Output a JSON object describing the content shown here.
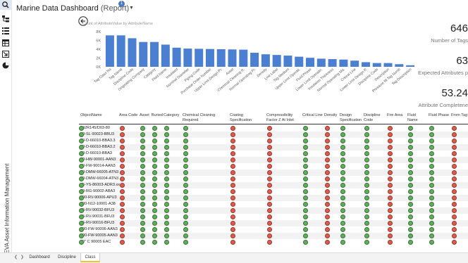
{
  "app": {
    "title": "Marine Data Dashboard",
    "subtitle": "(Report)",
    "badge": "1",
    "vertical_title": "AVEVA Asset Information Management"
  },
  "rail": {
    "icons": [
      "search-icon",
      "hierarchy-icon",
      "list-icon",
      "table-icon",
      "import-icon",
      "pie-icon"
    ]
  },
  "chart_data": {
    "type": "bar",
    "title": "Count of AttributeValue by AttributeName",
    "color": "#4a7fd2",
    "ylim": [
      0,
      8000
    ],
    "yticks": [
      "0K",
      "2K",
      "4K",
      "6K",
      "8K"
    ],
    "categories": [
      "Tag Class Na",
      "Tag Name",
      "Discipline Code",
      "Originating Company",
      "Category",
      "Fluid Name",
      "Insulated",
      "Nominal Diameter",
      "Piping Code",
      "Purchase Order Number",
      "Upper Limit Design Pr.",
      "Asset",
      "Chemical Cleaning R.",
      "Normal Operating Pr.",
      "Density",
      "Line Label",
      "Tag Medium",
      "Upper Limit Operati.",
      "Fluid Phase",
      "Lower Limit Operatin.",
      "Insulation Thickness",
      "Normal Operating Ma.",
      "Critical Line",
      "Lower Limit Design P.",
      "Discipline Code",
      "Description",
      "Pressure fill Tag Numb",
      "Tag Description"
    ],
    "values": [
      7150,
      7150,
      6500,
      5650,
      5650,
      5050,
      4350,
      4150,
      4100,
      4050,
      4000,
      3950,
      3900,
      3200,
      2850,
      2700,
      2550,
      2300,
      2050,
      1850,
      1750,
      1650,
      1400,
      1050,
      850,
      850,
      600,
      350
    ]
  },
  "kpis": [
    {
      "value": "646",
      "label": "Number of Tags"
    },
    {
      "value": "63",
      "label": "Expected Attributes p"
    },
    {
      "value": "53.24",
      "label": "Attribute Completene"
    }
  ],
  "table": {
    "columns": [
      "ObjectName",
      "Area Code",
      "Asset",
      "Buried",
      "Category",
      "Chemical Cleaning Required",
      "Coating Specification",
      "Compressibility Factor Z At Inlet",
      "Critical Line",
      "Density",
      "Design Specification",
      "Discipline Code",
      "Fire Area",
      "Fluid Name",
      "Fluid Phase",
      "From Tag"
    ],
    "rows": [
      {
        "name": "542R145/D03-80",
        "status": "rggggrrgrggrggrg"
      },
      {
        "name": "50-SL-90023-BBU3",
        "status": "rggggrrgrggrggrg"
      },
      {
        "name": "50-D-66010-BBA3.3",
        "status": "rggggrrgrggrggrg"
      },
      {
        "name": "50-D-66010-BBA3.2",
        "status": "rggggrrgrggrggrg"
      },
      {
        "name": "50-D-66010-BBA3",
        "status": "rggggrrgrggrggrg"
      },
      {
        "name": "50-HW-90001-AAN3",
        "status": "rggggrrgrggrggrg"
      },
      {
        "name": "50-FW-90014-AAN3",
        "status": "rggggrrgrggrggrg"
      },
      {
        "name": "50-DMW-66005-ATN3",
        "status": "rggggrrgrggrggrg"
      },
      {
        "name": "50-DMW-66004-ATN3",
        "status": "rggggrrgrggrggrg"
      },
      {
        "name": "25-YS-86003-ADR3.xx",
        "status": "rggggrrgrggrggrg"
      },
      {
        "name": "20-RG-90002-ABA3",
        "status": "rggggrrgrggrggrg"
      },
      {
        "name": "200-RV-90006-APU3",
        "status": "rggggrrgrggrggrg"
      },
      {
        "name": "200-N12-10001-A38",
        "status": "rggggrrgrggrggrg"
      },
      {
        "name": "15-RV-90032-BFU3",
        "status": "rggggrrgrggrggrg"
      },
      {
        "name": "15-RV-90031-BFU3",
        "status": "rggggrrgrggrggrg"
      },
      {
        "name": "15-RV-90016-BFU3",
        "status": "rggggrrgrggrggrg"
      },
      {
        "name": "100-FW-90006-AAN3",
        "status": "rggggrrgrggrggrg"
      },
      {
        "name": "100-FW-90005-AAN3",
        "status": "rggggrrgrggrggrg"
      },
      {
        "name": "10\" C 90005 EAC",
        "status": "rggggrrgrggrggrg"
      }
    ]
  },
  "tabs": {
    "items": [
      "Dashboard",
      "Discipline",
      "Class"
    ],
    "active": 2
  }
}
